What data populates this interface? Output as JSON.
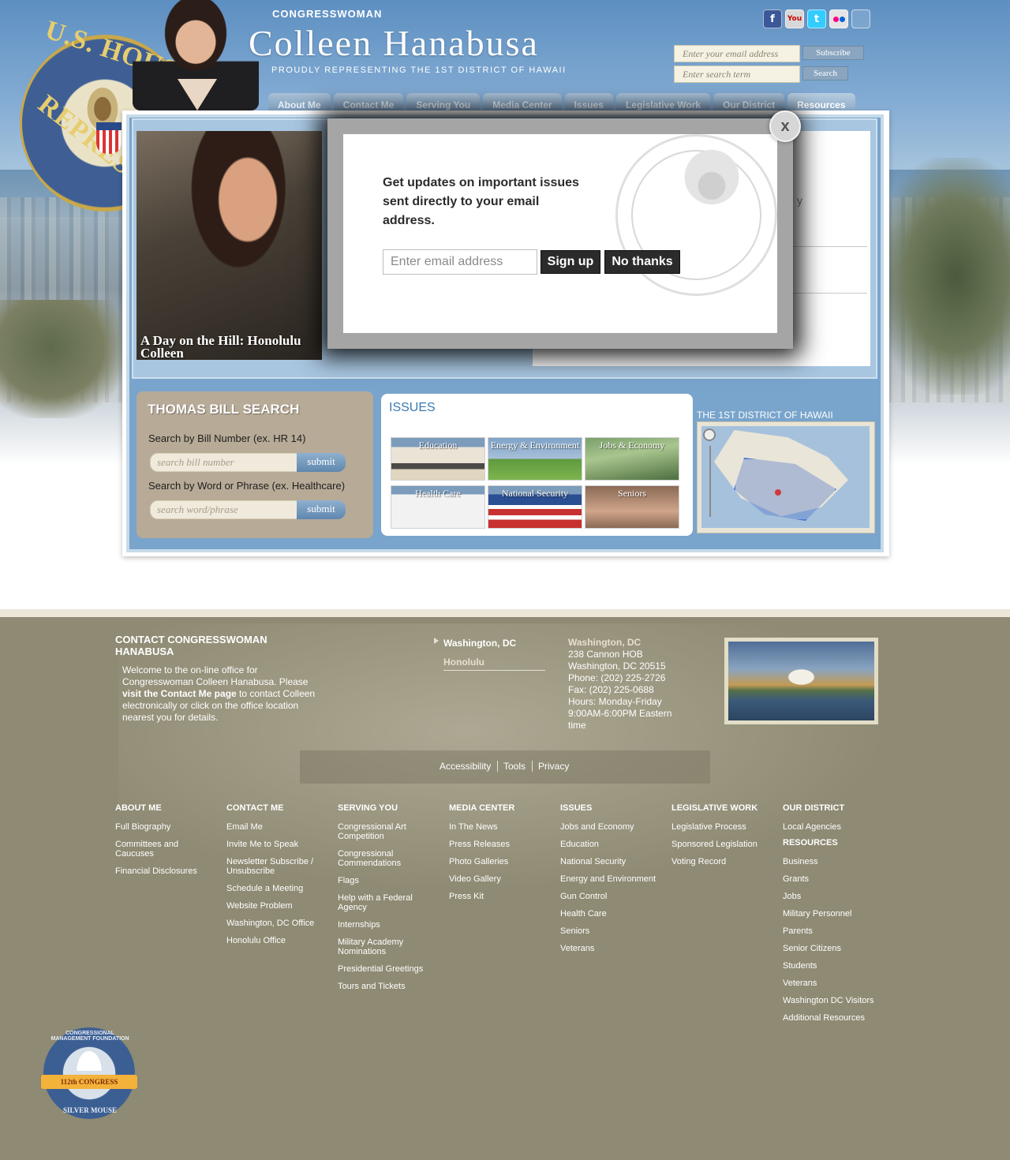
{
  "header": {
    "kicker": "CONGRESSWOMAN",
    "name": "Colleen Hanabusa",
    "tagline": "PROUDLY REPRESENTING THE 1ST DISTRICT OF HAWAII",
    "seal_text_top": "U.S. HOUSE OF",
    "seal_text_bottom": "REPRESENT",
    "email_placeholder": "Enter your email address",
    "subscribe_label": "Subscribe",
    "search_placeholder": "Enter search term",
    "search_label": "Search",
    "social": [
      "facebook-icon",
      "youtube-icon",
      "twitter-icon",
      "flickr-icon"
    ]
  },
  "nav": {
    "tabs": [
      "About Me",
      "Contact Me",
      "Serving You",
      "Media Center",
      "Issues",
      "Legislative Work",
      "Our District",
      "Resources"
    ],
    "active": "Resources"
  },
  "slideshow": {
    "caption": "A Day on the Hill: Honolulu Colleen",
    "ghost_text": "y"
  },
  "thomas": {
    "title": "THOMAS BILL SEARCH",
    "bill_label": "Search by Bill Number (ex. HR 14)",
    "bill_placeholder": "search bill number",
    "phrase_label": "Search by Word or Phrase (ex. Healthcare)",
    "phrase_placeholder": "search word/phrase",
    "submit_label": "submit"
  },
  "issues": {
    "title": "ISSUES",
    "tiles": [
      "Education",
      "Energy & Environment",
      "Jobs & Economy",
      "Health Care",
      "National Security",
      "Seniors"
    ]
  },
  "district": {
    "title": "THE 1ST DISTRICT OF HAWAII"
  },
  "modal": {
    "heading": "Get updates on important issues sent directly to your email address.",
    "email_placeholder": "Enter email address",
    "signup_label": "Sign up",
    "no_thanks_label": "No thanks",
    "close_label": "x"
  },
  "footer": {
    "contact_title": "CONTACT CONGRESSWOMAN HANABUSA",
    "contact_text_1": "Welcome to the on-line office for Congresswoman Colleen Hanabusa. Please ",
    "contact_link": "visit the Contact Me page",
    "contact_text_2": " to contact Colleen electronically or click on the office location nearest you for details.",
    "office_tabs": [
      "Washington, DC",
      "Honolulu"
    ],
    "office_addr": {
      "name": "Washington, DC",
      "line1": "238 Cannon HOB",
      "line2": "Washington, DC 20515",
      "phone": "Phone: (202) 225-2726",
      "fax": "Fax: (202) 225-0688",
      "hours": "Hours: Monday-Friday 9:00AM-6:00PM Eastern time"
    },
    "legal_links": [
      "Accessibility",
      "Tools",
      "Privacy"
    ],
    "columns": [
      {
        "title": "ABOUT ME",
        "links": [
          "Full Biography",
          "Committees and Caucuses",
          "Financial Disclosures"
        ]
      },
      {
        "title": "CONTACT ME",
        "links": [
          "Email Me",
          "Invite Me to Speak",
          "Newsletter Subscribe / Unsubscribe",
          "Schedule a Meeting",
          "Website Problem",
          "Washington, DC Office",
          "Honolulu Office"
        ]
      },
      {
        "title": "SERVING YOU",
        "links": [
          "Congressional Art Competition",
          "Congressional Commendations",
          "Flags",
          "Help with a Federal Agency",
          "Internships",
          "Military Academy Nominations",
          "Presidential Greetings",
          "Tours and Tickets"
        ]
      },
      {
        "title": "MEDIA CENTER",
        "links": [
          "In The News",
          "Press Releases",
          "Photo Galleries",
          "Video Gallery",
          "Press Kit"
        ]
      },
      {
        "title": "ISSUES",
        "links": [
          "Jobs and Economy",
          "Education",
          "National Security",
          "Energy and Environment",
          "Gun Control",
          "Health Care",
          "Seniors",
          "Veterans"
        ]
      },
      {
        "title": "LEGISLATIVE WORK",
        "links": [
          "Legislative Process",
          "Sponsored Legislation",
          "Voting Record"
        ]
      },
      {
        "title": "OUR DISTRICT",
        "links": [
          "Local Agencies"
        ]
      },
      {
        "title": "RESOURCES",
        "links": [
          "Business",
          "Grants",
          "Jobs",
          "Military Personnel",
          "Parents",
          "Senior Citizens",
          "Students",
          "Veterans",
          "Washington DC Visitors",
          "Additional Resources"
        ]
      }
    ],
    "badge": {
      "top": "CONGRESSIONAL MANAGEMENT FOUNDATION",
      "ribbon": "112th CONGRESS",
      "bottom": "SILVER MOUSE"
    }
  }
}
